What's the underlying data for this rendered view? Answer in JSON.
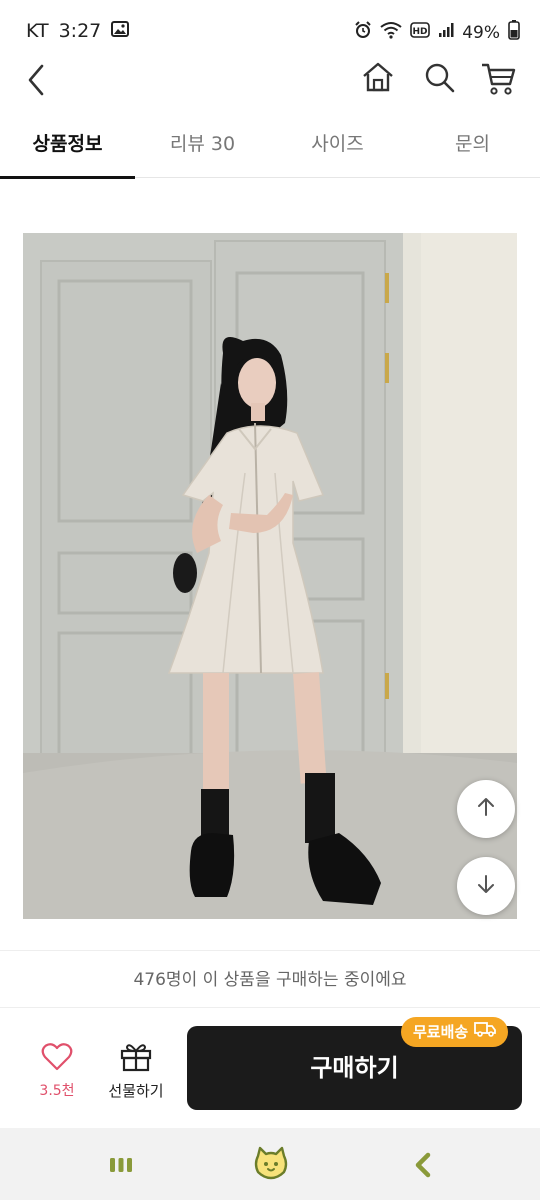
{
  "status_bar": {
    "carrier": "KT",
    "time": "3:27",
    "battery_percent": "49%",
    "icons": [
      "gallery-icon",
      "alarm-icon",
      "wifi-icon",
      "hd-icon",
      "signal-icon",
      "battery-icon"
    ]
  },
  "nav": {
    "icons": [
      "back-icon",
      "home-icon",
      "search-icon",
      "cart-icon"
    ]
  },
  "tabs": [
    {
      "label": "상품정보",
      "active": true
    },
    {
      "label": "리뷰 30",
      "active": false
    },
    {
      "label": "사이즈",
      "active": false
    },
    {
      "label": "문의",
      "active": false
    }
  ],
  "product": {
    "image": "product-photo"
  },
  "scroll_buttons": [
    "scroll-up-icon",
    "scroll-down-icon"
  ],
  "purchase_notice": "476명이 이 상품을 구매하는 중이에요",
  "actions": {
    "like_count": "3.5천",
    "gift_label": "선물하기",
    "buy_label": "구매하기",
    "shipping_badge": "무료배송"
  },
  "colors": {
    "accent_pink": "#e0506b",
    "buy_button": "#1b1b1b",
    "badge": "#f5a623"
  }
}
